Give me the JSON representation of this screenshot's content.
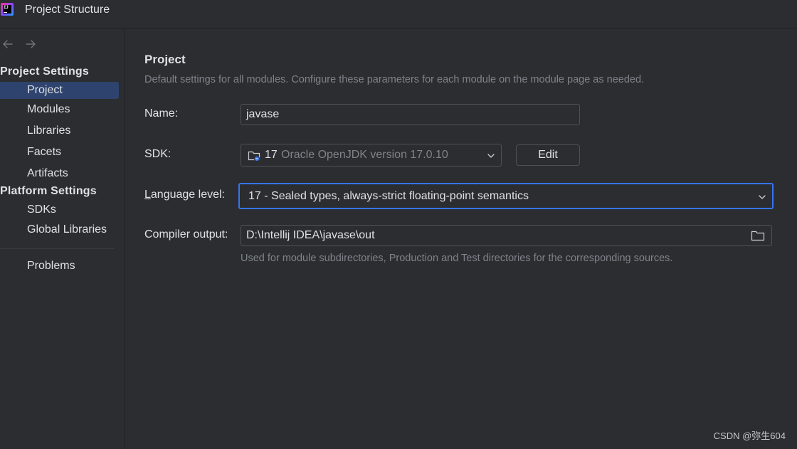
{
  "window": {
    "title": "Project Structure",
    "logo_text": "IJ"
  },
  "nav": {
    "back_icon": "arrow-left-icon",
    "forward_icon": "arrow-right-icon"
  },
  "sidebar": {
    "project_settings_header": "Project Settings",
    "project_settings_items": [
      "Project",
      "Modules",
      "Libraries",
      "Facets",
      "Artifacts"
    ],
    "platform_settings_header": "Platform Settings",
    "platform_settings_items": [
      "SDKs",
      "Global Libraries"
    ],
    "problems_label": "Problems",
    "selected": "Project"
  },
  "main": {
    "title": "Project",
    "description": "Default settings for all modules. Configure these parameters for each module on the module page as needed.",
    "name_label": "Name:",
    "name_value": "javase",
    "sdk_label": "SDK:",
    "sdk_version": "17",
    "sdk_name": "Oracle OpenJDK version 17.0.10",
    "sdk_icon": "jdk-folder-icon",
    "edit_button": "Edit",
    "language_level_label_accel": "L",
    "language_level_label_rest": "anguage level:",
    "language_level_value": "17 - Sealed types, always-strict floating-point semantics",
    "compiler_output_label": "Compiler output:",
    "compiler_output_value": "D:\\Intellij IDEA\\javase\\out",
    "compiler_output_hint": "Used for module subdirectories, Production and Test directories for the corresponding sources.",
    "browse_icon": "folder-icon"
  },
  "watermark": "CSDN @弥生604",
  "colors": {
    "background": "#2b2d30",
    "selection": "#2e436e",
    "focus": "#3574f0",
    "muted_text": "#7f838a"
  }
}
